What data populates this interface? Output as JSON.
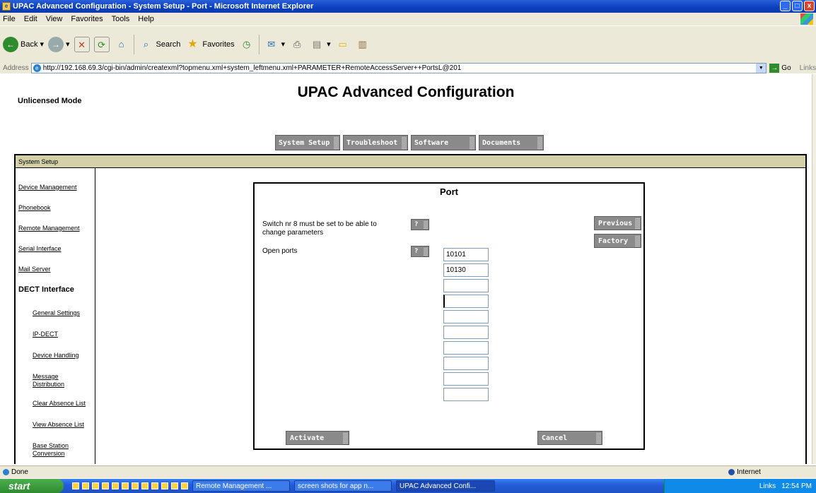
{
  "window": {
    "title": "UPAC Advanced Configuration - System Setup - Port - Microsoft Internet Explorer",
    "controls": [
      "_",
      "□",
      "x"
    ]
  },
  "menubar": [
    "File",
    "Edit",
    "View",
    "Favorites",
    "Tools",
    "Help"
  ],
  "toolbar": {
    "back": "Back",
    "search": "Search",
    "favorites": "Favorites"
  },
  "address": {
    "label": "Address",
    "url": "http://192.168.69.3/cgi-bin/admin/createxml?topmenu.xml+system_leftmenu.xml+PARAMETER+RemoteAccessServer++PortsL@201",
    "go": "Go",
    "links": "Links"
  },
  "page": {
    "mode": "Unlicensed Mode",
    "title": "UPAC Advanced Configuration",
    "topmenu": [
      "System Setup",
      "Troubleshoot",
      "Software",
      "Documents"
    ],
    "section_header": "System Setup",
    "leftmenu": [
      "Device Management",
      "Phonebook",
      "Remote Management",
      "Serial Interface",
      "Mail Server",
      "DECT Interface",
      "General Settings",
      "IP-DECT",
      "Device Handling",
      "Message Distribution",
      "Clear Absence List",
      "View Absence List",
      "Base Station Conversion"
    ],
    "form": {
      "title": "Port",
      "switch_note": "Switch nr 8 must be set to be able to change parameters",
      "open_ports_label": "Open ports",
      "help_label": "?",
      "ports": [
        "10101",
        "10130",
        "",
        "",
        "",
        "",
        "",
        "",
        "",
        ""
      ],
      "previous": "Previous",
      "factory": "Factory",
      "activate": "Activate",
      "cancel": "Cancel"
    }
  },
  "statusbar": {
    "status": "Done",
    "zone": "Internet"
  },
  "taskbar": {
    "start": "start",
    "tasks": [
      "Remote Management ...",
      "screen shots for app n...",
      "UPAC Advanced Confi..."
    ],
    "links": "Links",
    "clock": "12:54 PM"
  }
}
